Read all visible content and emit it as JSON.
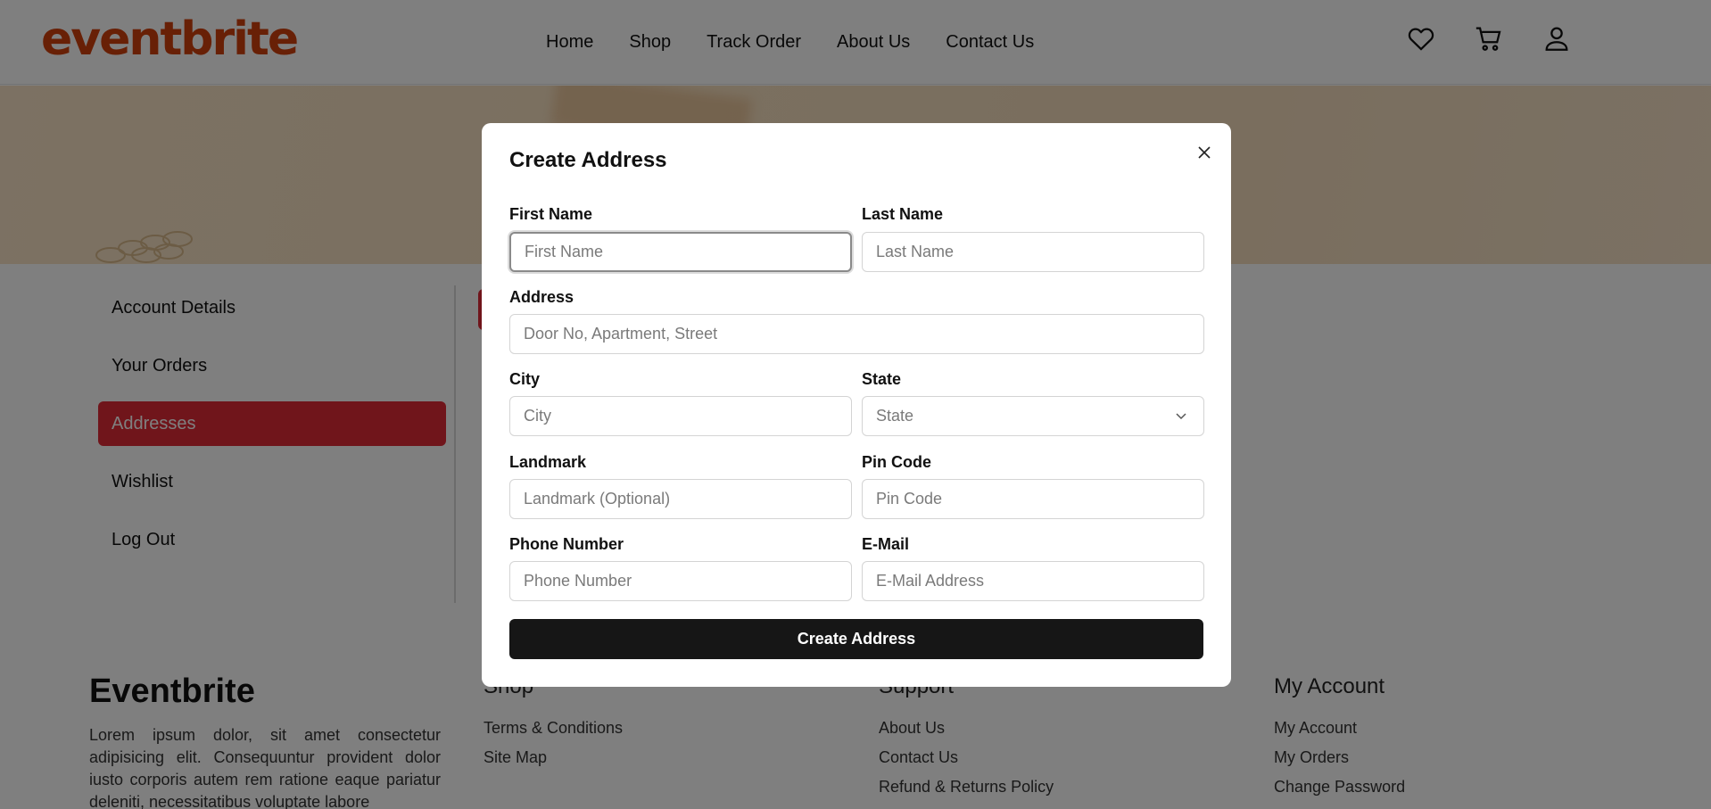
{
  "header": {
    "logo": "eventbrite",
    "nav": [
      "Home",
      "Shop",
      "Track Order",
      "About Us",
      "Contact Us"
    ],
    "icons": [
      "heart-icon",
      "cart-icon",
      "user-icon"
    ]
  },
  "sidebar": {
    "items": [
      {
        "label": "Account Details"
      },
      {
        "label": "Your Orders"
      },
      {
        "label": "Addresses",
        "active": true
      },
      {
        "label": "Wishlist"
      },
      {
        "label": "Log Out"
      }
    ]
  },
  "modal": {
    "title": "Create Address",
    "fields": {
      "first_name": {
        "label": "First Name",
        "placeholder": "First Name",
        "value": ""
      },
      "last_name": {
        "label": "Last Name",
        "placeholder": "Last Name",
        "value": ""
      },
      "address": {
        "label": "Address",
        "placeholder": "Door No, Apartment, Street",
        "value": ""
      },
      "city": {
        "label": "City",
        "placeholder": "City",
        "value": ""
      },
      "state": {
        "label": "State",
        "selected": "State"
      },
      "landmark": {
        "label": "Landmark",
        "placeholder": "Landmark (Optional)",
        "value": ""
      },
      "pin_code": {
        "label": "Pin Code",
        "placeholder": "Pin Code",
        "value": ""
      },
      "phone": {
        "label": "Phone Number",
        "placeholder": "Phone Number",
        "value": ""
      },
      "email": {
        "label": "E-Mail",
        "placeholder": "E-Mail Address",
        "value": ""
      }
    },
    "submit_label": "Create Address"
  },
  "footer": {
    "brand": "Eventbrite",
    "about": "Lorem ipsum dolor, sit amet consectetur adipisicing elit. Consequuntur provident dolor iusto corporis autem rem ratione eaque pariatur deleniti, necessitatibus voluptate labore",
    "columns": [
      {
        "title": "Shop",
        "links": [
          "Terms & Conditions",
          "Site Map"
        ]
      },
      {
        "title": "Support",
        "links": [
          "About Us",
          "Contact Us",
          "Refund & Returns Policy"
        ]
      },
      {
        "title": "My Account",
        "links": [
          "My Account",
          "My Orders",
          "Change Password"
        ]
      }
    ]
  },
  "colors": {
    "brand": "#d1410c",
    "active": "#e02b37",
    "button": "#161616"
  }
}
